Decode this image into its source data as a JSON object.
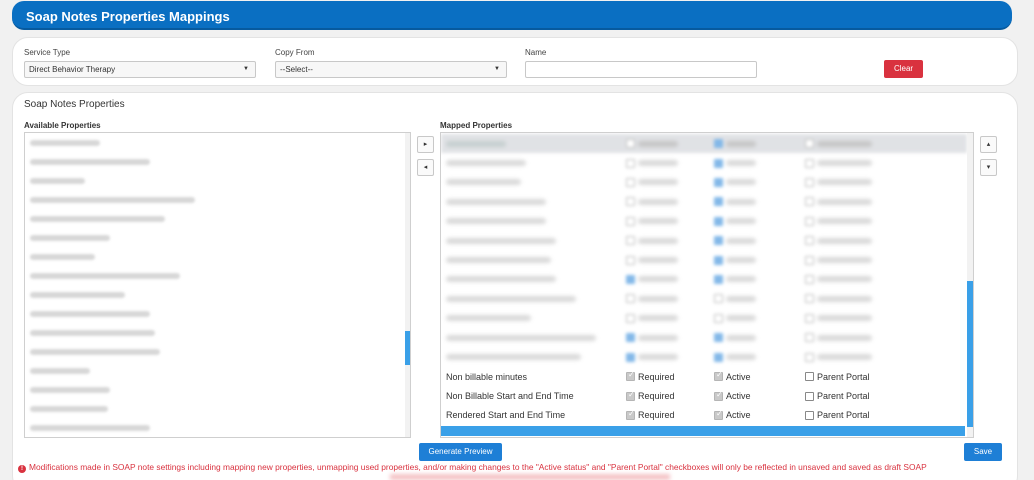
{
  "header": {
    "title": "Soap Notes Properties Mappings"
  },
  "filters": {
    "service_type_label": "Service Type",
    "service_type_value": "Direct Behavior Therapy",
    "copy_from_label": "Copy From",
    "copy_from_value": "--Select--",
    "name_label": "Name",
    "name_value": "",
    "clear_label": "Clear"
  },
  "section_title": "Soap Notes Properties",
  "available": {
    "title": "Available Properties",
    "items": [
      "",
      "",
      "",
      "",
      "",
      "",
      "",
      "",
      "",
      "",
      "",
      "",
      "",
      "",
      "",
      ""
    ]
  },
  "mapped": {
    "title": "Mapped Properties",
    "visible_rows": [
      {
        "name": "Non billable minutes",
        "required": "Required",
        "active": "Active",
        "portal": "Parent Portal"
      },
      {
        "name": "Non Billable Start and End Time",
        "required": "Required",
        "active": "Active",
        "portal": "Parent Portal"
      },
      {
        "name": "Rendered Start and End Time",
        "required": "Required",
        "active": "Active",
        "portal": "Parent Portal"
      }
    ]
  },
  "buttons": {
    "generate_preview": "Generate Preview",
    "save": "Save",
    "move_right": "▸",
    "move_left": "◂",
    "move_up": "▴",
    "move_down": "▾"
  },
  "footer": {
    "message": "Modifications made in SOAP note settings including mapping new properties, unmapping used properties, and/or making changes to the \"Active status\" and \"Parent Portal\" checkboxes will only be reflected in unsaved and saved as draft SOAP"
  },
  "colors": {
    "accent": "#0a6fc2",
    "danger": "#d9323f",
    "primary_button": "#1e7fd6"
  }
}
